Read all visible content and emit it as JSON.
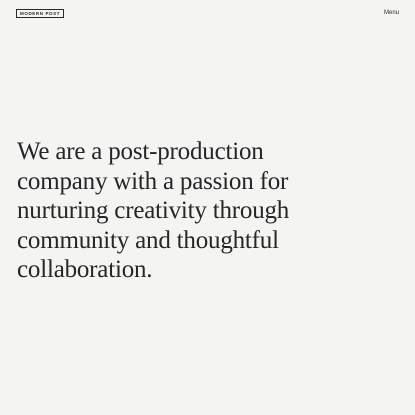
{
  "header": {
    "logo_text": "MODERN POST",
    "menu_label": "Menu"
  },
  "hero": {
    "lines": [
      "We are a post-production",
      "company with a passion for",
      "nurturing creativity through",
      "community and thoughtful",
      "collaboration."
    ]
  },
  "colors": {
    "background": "#f4f4f3",
    "text": "#262626"
  }
}
